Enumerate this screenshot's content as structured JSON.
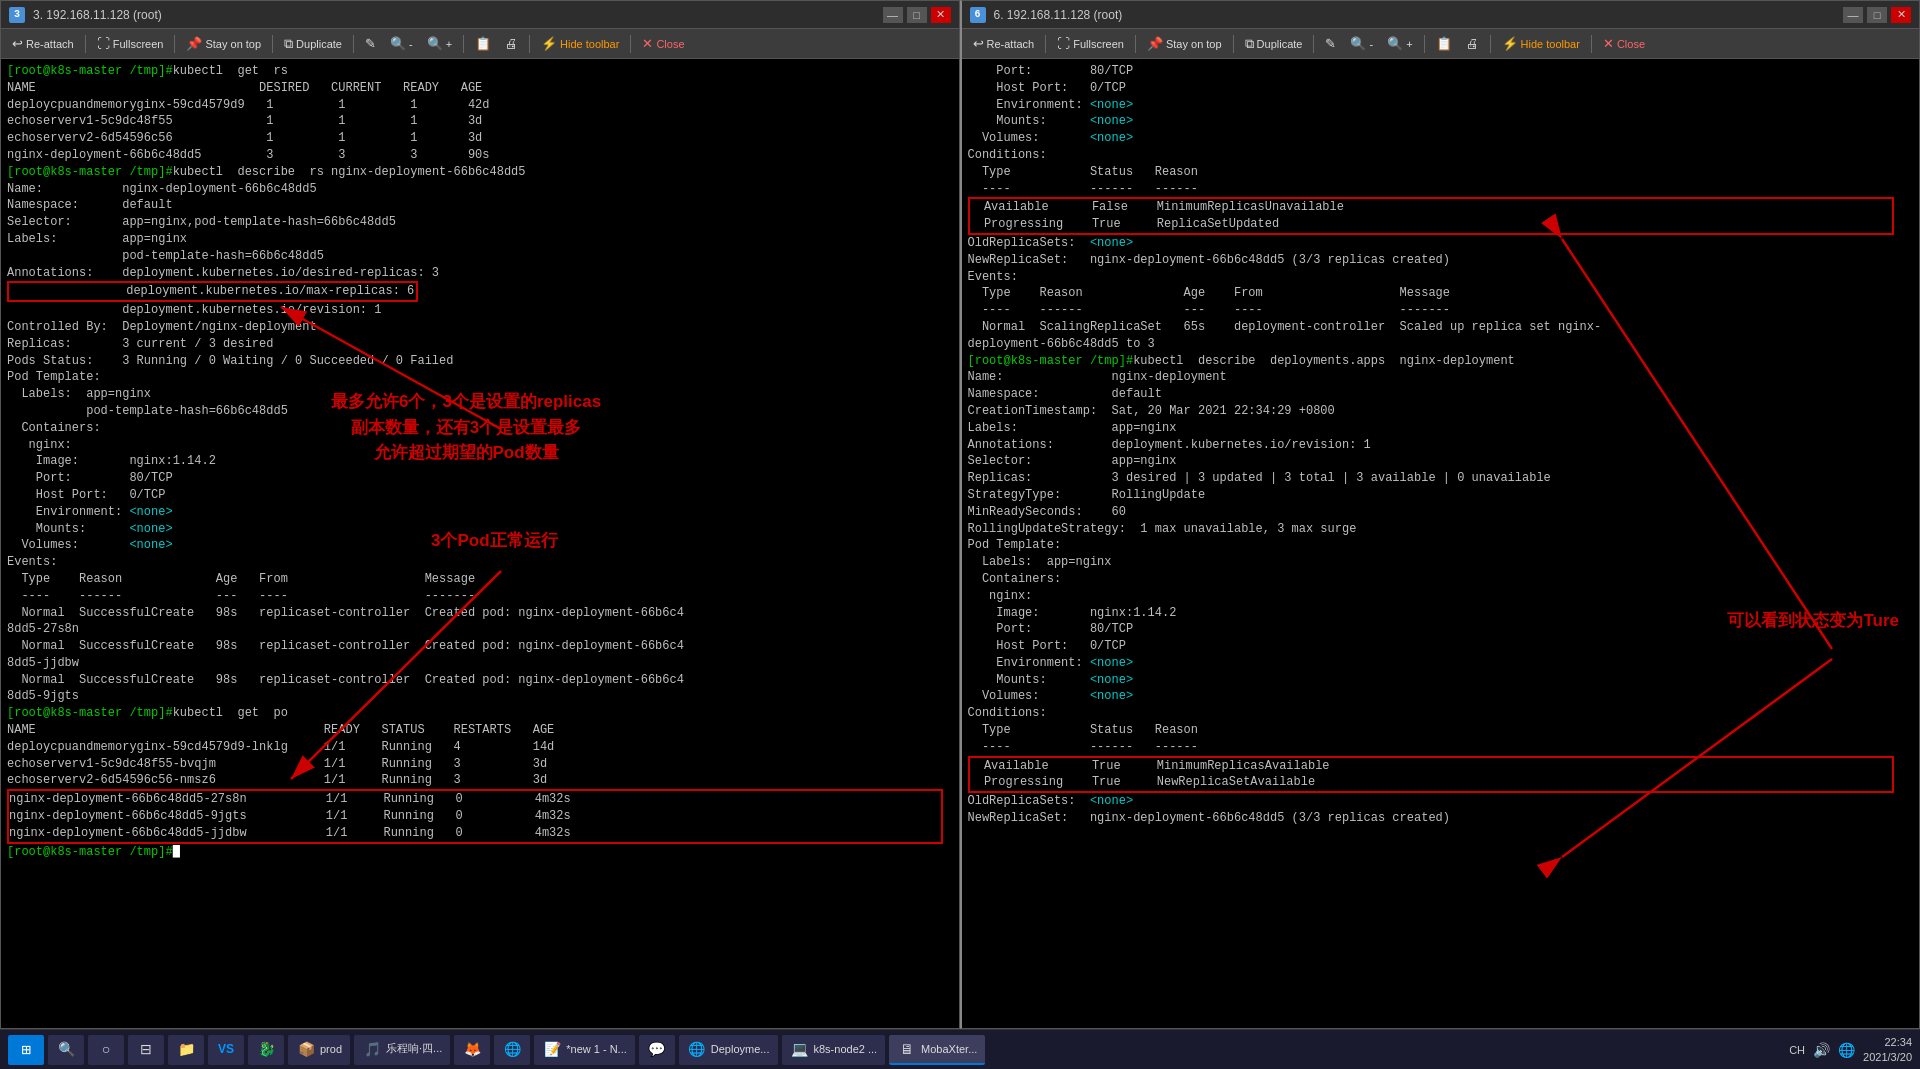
{
  "windows": [
    {
      "id": "window-3",
      "title": "3. 192.168.11.128 (root)",
      "toolbar": {
        "buttons": [
          {
            "label": "Re-attach",
            "icon": "↩"
          },
          {
            "label": "Fullscreen",
            "icon": "⛶"
          },
          {
            "label": "Stay on top",
            "icon": "📌"
          },
          {
            "label": "Duplicate",
            "icon": "⧉"
          },
          {
            "label": "✎",
            "icon": "✎"
          },
          {
            "label": "🔍-",
            "icon": "🔍"
          },
          {
            "label": "🔍+",
            "icon": "🔍"
          },
          {
            "label": "📋",
            "icon": "📋"
          },
          {
            "label": "🖨",
            "icon": "🖨"
          },
          {
            "label": "Hide toolbar",
            "icon": "⚡"
          },
          {
            "label": "Close",
            "icon": "✕"
          }
        ]
      },
      "content_left": "[root@k8s-master /tmp]#kubectl  get  rs\nNAME                               DESIRED   CURRENT   READY   AGE\ndeploycpuandmemoryginx-59cd4579d9   1         1         1       42d\nechoserverv1-5c9dc48f55             1         1         1       3d\nechoserverv2-6d54596c56             1         1         1       3d\nnginx-deployment-66b6c48dd5         3         3         3       90s\n[root@k8s-master /tmp]#kubectl  describe  rs nginx-deployment-66b6c48dd5\nName:           nginx-deployment-66b6c48dd5\nNamespace:      default\nSelector:       app=nginx,pod-template-hash=66b6c48dd5\nLabels:         app=nginx\n                pod-template-hash=66b6c48dd5\nAnnotations:    deployment.kubernetes.io/desired-replicas: 3\n                deployment.kubernetes.io/max-replicas: 6\n                deployment.kubernetes.io/revision: 1\nControlled By:  Deployment/nginx-deployment\nReplicas:       3 current / 3 desired\nPods Status:    3 Running / 0 Waiting / 0 Succeeded / 0 Failed\nPod Template:\n  Labels:  app=nginx\n           pod-template-hash=66b6c48dd5\n  Containers:\n   nginx:\n    Image:       nginx:1.14.2\n    Port:        80/TCP\n    Host Port:   0/TCP\n    Environment: <none>\n    Mounts:      <none>\n  Volumes:       <none>\nEvents:\n  Type    Reason             Age   From                   Message\n  ----    ------             ---   ----                   -------\n  Normal  SuccessfulCreate   98s   replicaset-controller  Created pod: nginx-deployment-66b6c4\n8dd5-27s8n\n  Normal  SuccessfulCreate   98s   replicaset-controller  Created pod: nginx-deployment-66b6c4\n8dd5-jjdbw\n  Normal  SuccessfulCreate   98s   replicaset-controller  Created pod: nginx-deployment-66b6c4\n8dd5-9jgts\n[root@k8s-master /tmp]#kubectl  get  po\nNAME                                        READY   STATUS    RESTARTS   AGE\ndeploycpuandmemoryginx-59cd4579d9-lnklg     1/1     Running   4          14d\nechoserverv1-5c9dc48f55-bvqjm               1/1     Running   3          3d\nechoserverv2-6d54596c56-nmsz6               1/1     Running   3          3d\nnginx-deployment-66b6c48dd5-27s8n           1/1     Running   0          4m32s\nnginx-deployment-66b6c48dd5-9jgts           1/1     Running   0          4m32s\nnginx-deployment-66b6c48dd5-jjdbw           1/1     Running   0          4m32s\n[root@k8s-master /tmp]#"
    },
    {
      "id": "window-6",
      "title": "6. 192.168.11.128 (root)",
      "toolbar": {
        "buttons": [
          {
            "label": "Re-attach",
            "icon": "↩"
          },
          {
            "label": "Fullscreen",
            "icon": "⛶"
          },
          {
            "label": "Stay on top",
            "icon": "📌"
          },
          {
            "label": "Duplicate",
            "icon": "⧉"
          },
          {
            "label": "✎",
            "icon": "✎"
          },
          {
            "label": "🔍-",
            "icon": "🔍"
          },
          {
            "label": "🔍+",
            "icon": "🔍"
          },
          {
            "label": "📋",
            "icon": "📋"
          },
          {
            "label": "🖨",
            "icon": "🖨"
          },
          {
            "label": "Hide toolbar",
            "icon": "⚡"
          },
          {
            "label": "Close",
            "icon": "✕"
          }
        ]
      },
      "content_right": "    Port:        80/TCP\n    Host Port:   0/TCP\n    Environment: <none>\n    Mounts:      <none>\n  Volumes:       <none>\nConditions:\n  Type           Status   Reason\n  ----           ------   ------\n  Available      False    MinimumReplicasUnavailable\n  Progressing    True     ReplicaSetUpdated\nOldReplicaSets:  <none>\nNewReplicaSet:   nginx-deployment-66b6c48dd5 (3/3 replicas created)\nEvents:\n  Type    Reason              Age    From                   Message\n  ----    ------              ---    ----                   -------\n  Normal  ScalingReplicaSet   65s    deployment-controller  Scaled up replica set nginx-\ndeployment-66b6c48dd5 to 3\n[root@k8s-master /tmp]#kubectl  describe  deployments.apps  nginx-deployment\nName:               nginx-deployment\nNamespace:          default\nCreationTimestamp:  Sat, 20 Mar 2021 22:34:29 +0800\nLabels:             app=nginx\nAnnotations:        deployment.kubernetes.io/revision: 1\nSelector:           app=nginx\nReplicas:           3 desired | 3 updated | 3 total | 3 available | 0 unavailable\nStrategyType:       RollingUpdate\nMinReadySeconds:    60\nRollingUpdateStrategy:  1 max unavailable, 3 max surge\nPod Template:\n  Labels:  app=nginx\n  Containers:\n   nginx:\n    Image:       nginx:1.14.2\n    Port:        80/TCP\n    Host Port:   0/TCP\n    Environment: <none>\n    Mounts:      <none>\n  Volumes:       <none>\nConditions:\n  Type           Status   Reason\n  ----           ------   ------\n  Available      True     MinimumReplicasAvailable\n  Progressing    True     NewReplicaSetAvailable\nOldReplicaSets:  <none>\nNewReplicaSet:   nginx-deployment-66b6c48dd5 (3/3 replicas created)"
    }
  ],
  "annotations": {
    "left": {
      "box_text": "deployment.kubernetes.io/max-replicas: 6",
      "annotation1": "最多允许6个，3个是设置的replicas\n副本数量，还有3个是设置最多\n允许超过期望的Pod数量",
      "annotation2": "3个Pod正常运行"
    },
    "right": {
      "box1_text": "Available      False    MinimumReplicasUnavailable\n  Progressing    True     ReplicaSetUpdated",
      "box2_text": "Available      True     MinimumReplicasAvailable\n  Progressing    True     NewReplicaSetAvailable",
      "annotation1": "可以看到状态变为Ture"
    }
  },
  "taskbar": {
    "start_icon": "⊞",
    "items": [
      {
        "label": "",
        "icon": "🔍",
        "active": false
      },
      {
        "label": "",
        "icon": "○",
        "active": false
      },
      {
        "label": "",
        "icon": "⊟",
        "active": false
      },
      {
        "label": "",
        "icon": "📁",
        "active": false
      },
      {
        "label": "",
        "icon": "VS",
        "active": false
      },
      {
        "label": "",
        "icon": "🐉",
        "active": false
      },
      {
        "label": "prod",
        "icon": "📦",
        "active": false
      },
      {
        "label": "乐程响·四...",
        "icon": "🎵",
        "active": false
      },
      {
        "label": "",
        "icon": "🔥",
        "active": false
      },
      {
        "label": "",
        "icon": "🌐",
        "active": false
      },
      {
        "label": "*new 1 - N...",
        "icon": "📝",
        "active": false
      },
      {
        "label": "",
        "icon": "💬",
        "active": false
      },
      {
        "label": "Deployme...",
        "icon": "🌐",
        "active": false
      },
      {
        "label": "k8s-node2 ...",
        "icon": "💻",
        "active": false
      },
      {
        "label": "MobaXter...",
        "icon": "🖥",
        "active": true
      }
    ],
    "tray": {
      "icons": [
        "CH",
        "🔊",
        "🌐",
        "⌨"
      ],
      "time": "22:34",
      "date": "2021/3/20"
    }
  }
}
